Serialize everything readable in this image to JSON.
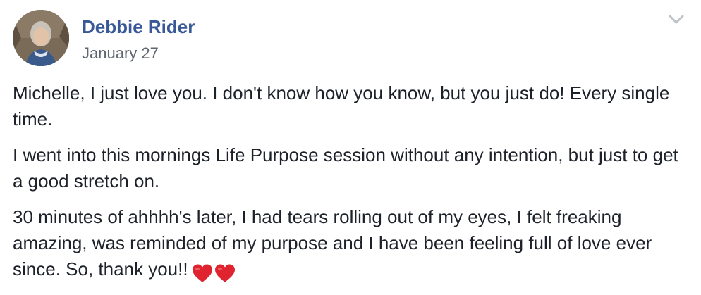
{
  "post": {
    "author": "Debbie Rider",
    "timestamp": "January 27",
    "paragraphs": [
      "Michelle, I just love you. I don't know how you know, but you just do! Every single time.",
      "I went into this mornings Life Purpose session without any intention, but just to get a good stretch on.",
      "30 minutes of ahhhh's later, I had tears rolling out of my eyes, I felt freaking amazing, was reminded of my purpose and I have been feeling full of love ever since. So, thank you!!"
    ],
    "emojis": [
      "heart-icon",
      "heart-icon"
    ]
  },
  "colors": {
    "author": "#385898",
    "timestamp": "#606770",
    "body": "#1d2129",
    "heart": "#e0242f",
    "chevron": "#bec3c9"
  },
  "icons": {
    "avatar": "avatar",
    "menu": "chevron-down-icon"
  }
}
